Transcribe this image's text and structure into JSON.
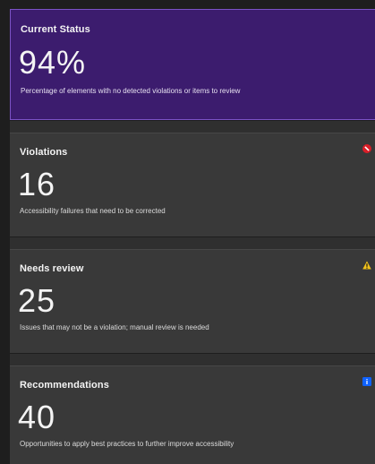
{
  "status": {
    "title": "Current Status",
    "value": "94%",
    "description": "Percentage of elements with no detected violations or items to review"
  },
  "violations": {
    "title": "Violations",
    "value": "16",
    "description": "Accessibility failures that need to be corrected",
    "icon": "violation-icon",
    "color": "#da1e28"
  },
  "needs_review": {
    "title": "Needs review",
    "value": "25",
    "description": "Issues that may not be a violation; manual review is needed",
    "icon": "warning-icon",
    "color": "#f1c21b"
  },
  "recommendations": {
    "title": "Recommendations",
    "value": "40",
    "description": "Opportunities to apply best practices to further improve accessibility",
    "icon": "info-icon",
    "color": "#0f62fe"
  }
}
